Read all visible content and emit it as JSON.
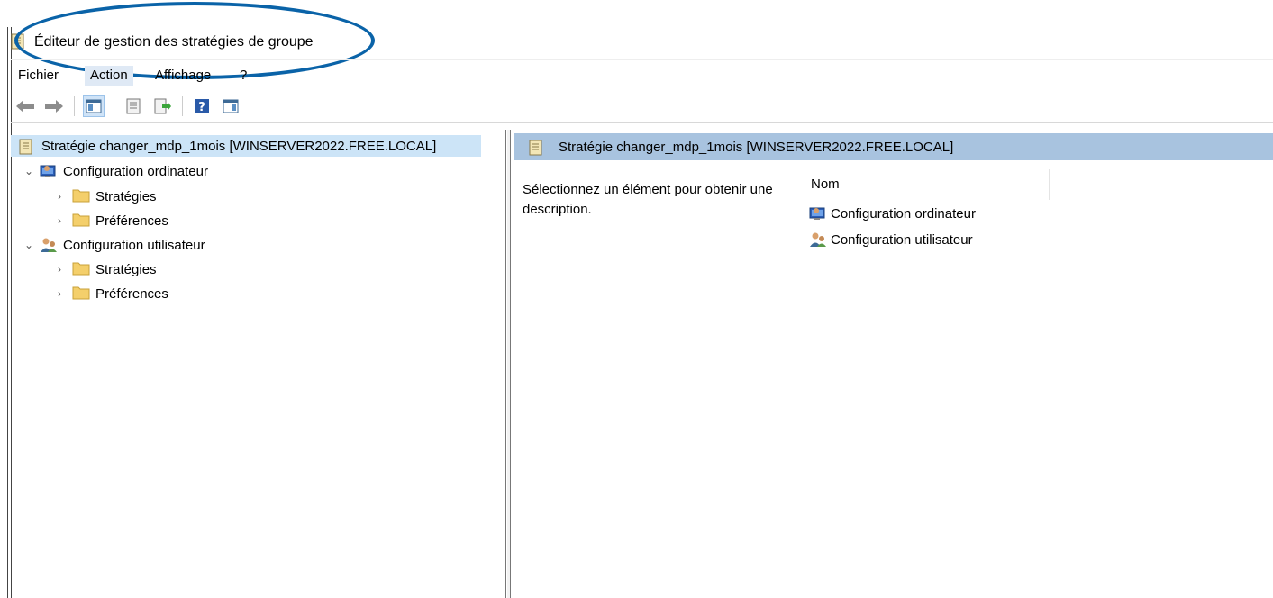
{
  "window": {
    "title": "Éditeur de gestion des stratégies de groupe"
  },
  "menu": {
    "items": [
      {
        "label": "Fichier"
      },
      {
        "label": "Action"
      },
      {
        "label": "Affichage"
      },
      {
        "label": "?"
      }
    ]
  },
  "tree": {
    "root": "Stratégie changer_mdp_1mois [WINSERVER2022.FREE.LOCAL]",
    "computer": "Configuration ordinateur",
    "computer_children": [
      "Stratégies",
      "Préférences"
    ],
    "user": "Configuration utilisateur",
    "user_children": [
      "Stratégies",
      "Préférences"
    ]
  },
  "details": {
    "header": "Stratégie changer_mdp_1mois [WINSERVER2022.FREE.LOCAL]",
    "description": "Sélectionnez un élément pour obtenir une description.",
    "column_name": "Nom",
    "items": [
      "Configuration ordinateur",
      "Configuration utilisateur"
    ]
  },
  "colors": {
    "highlight_ellipse": "#0a63a8",
    "selected_row": "#cce4f7",
    "header_bg": "#a8c3df"
  }
}
